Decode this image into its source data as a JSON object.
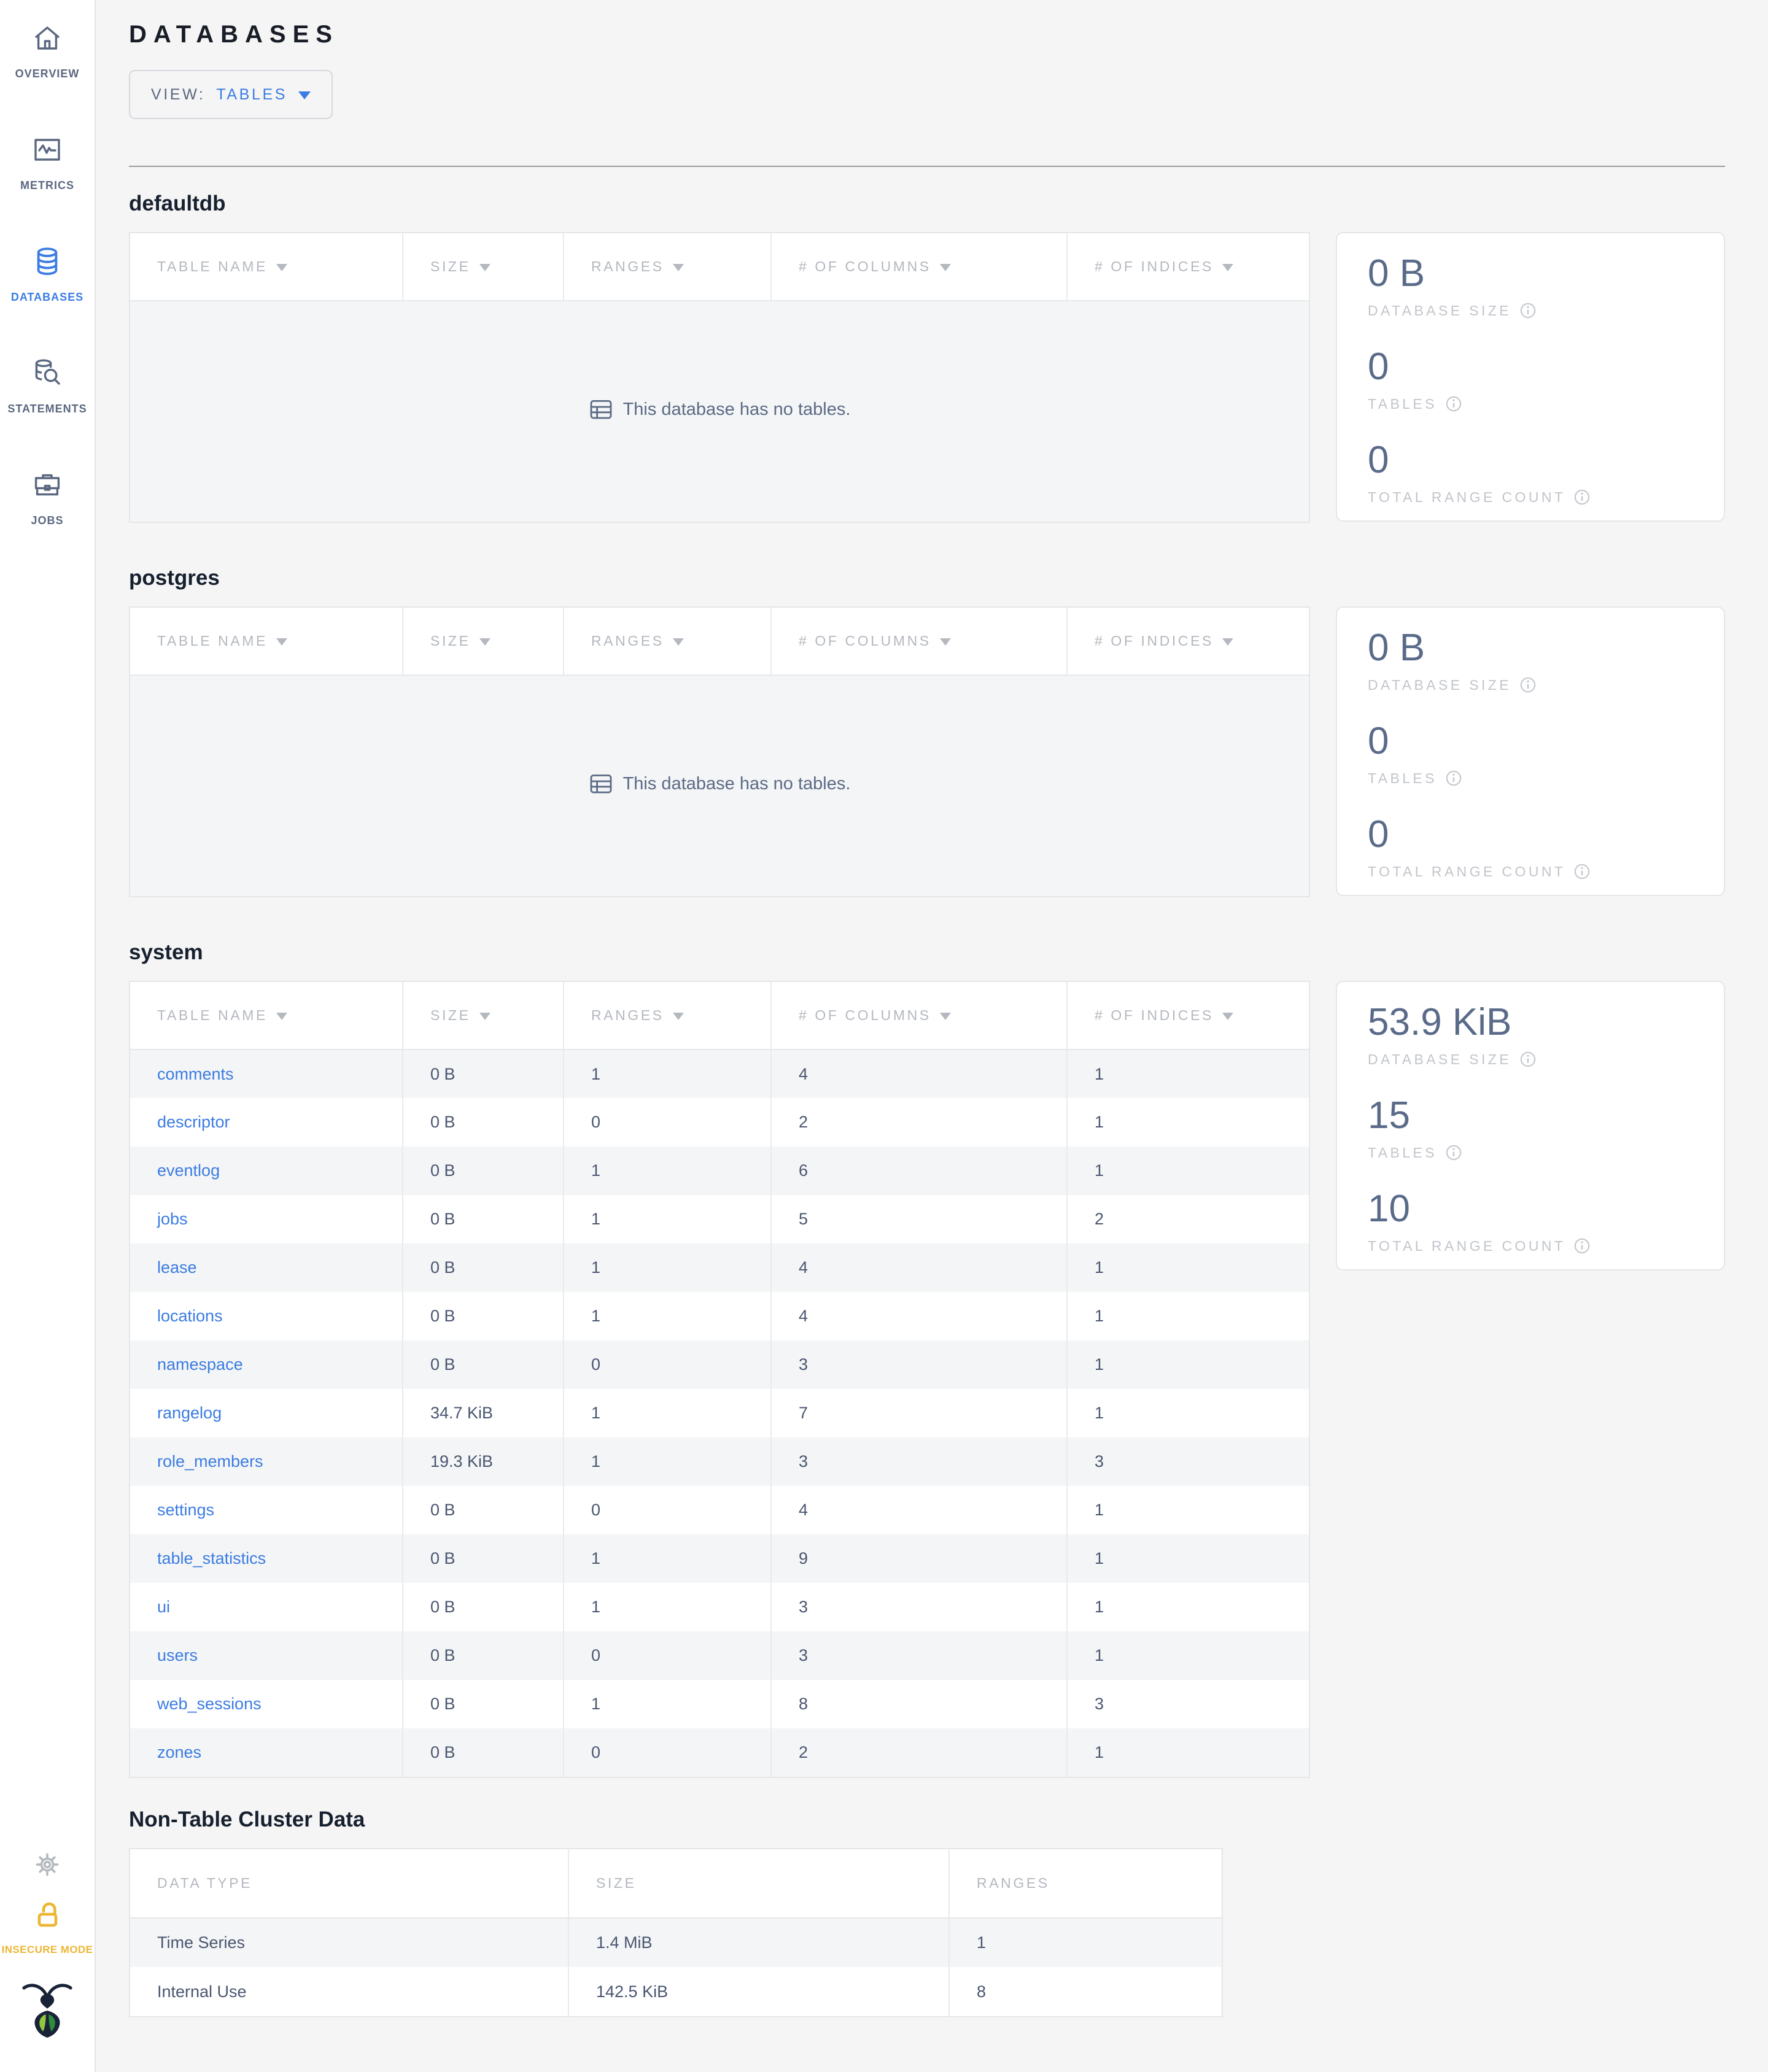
{
  "sidebar": {
    "items": [
      {
        "label": "OVERVIEW",
        "icon": "home-icon",
        "active": false
      },
      {
        "label": "METRICS",
        "icon": "metrics-icon",
        "active": false
      },
      {
        "label": "DATABASES",
        "icon": "database-icon",
        "active": true
      },
      {
        "label": "STATEMENTS",
        "icon": "statements-icon",
        "active": false
      },
      {
        "label": "JOBS",
        "icon": "jobs-icon",
        "active": false
      }
    ],
    "insecure_label": "INSECURE MODE"
  },
  "header": {
    "title": "DATABASES",
    "view_label": "VIEW:",
    "view_value": "TABLES"
  },
  "table_columns": [
    "TABLE NAME",
    "SIZE",
    "RANGES",
    "# OF COLUMNS",
    "# OF INDICES"
  ],
  "stat_labels": {
    "size": "DATABASE SIZE",
    "tables": "TABLES",
    "ranges": "TOTAL RANGE COUNT"
  },
  "empty_message": "This database has no tables.",
  "databases": [
    {
      "name": "defaultdb",
      "empty": true,
      "stats": {
        "size": "0 B",
        "tables": "0",
        "ranges": "0"
      },
      "rows": []
    },
    {
      "name": "postgres",
      "empty": true,
      "stats": {
        "size": "0 B",
        "tables": "0",
        "ranges": "0"
      },
      "rows": []
    },
    {
      "name": "system",
      "empty": false,
      "stats": {
        "size": "53.9 KiB",
        "tables": "15",
        "ranges": "10"
      },
      "rows": [
        {
          "name": "comments",
          "size": "0 B",
          "ranges": "1",
          "columns": "4",
          "indices": "1"
        },
        {
          "name": "descriptor",
          "size": "0 B",
          "ranges": "0",
          "columns": "2",
          "indices": "1"
        },
        {
          "name": "eventlog",
          "size": "0 B",
          "ranges": "1",
          "columns": "6",
          "indices": "1"
        },
        {
          "name": "jobs",
          "size": "0 B",
          "ranges": "1",
          "columns": "5",
          "indices": "2"
        },
        {
          "name": "lease",
          "size": "0 B",
          "ranges": "1",
          "columns": "4",
          "indices": "1"
        },
        {
          "name": "locations",
          "size": "0 B",
          "ranges": "1",
          "columns": "4",
          "indices": "1"
        },
        {
          "name": "namespace",
          "size": "0 B",
          "ranges": "0",
          "columns": "3",
          "indices": "1"
        },
        {
          "name": "rangelog",
          "size": "34.7 KiB",
          "ranges": "1",
          "columns": "7",
          "indices": "1"
        },
        {
          "name": "role_members",
          "size": "19.3 KiB",
          "ranges": "1",
          "columns": "3",
          "indices": "3"
        },
        {
          "name": "settings",
          "size": "0 B",
          "ranges": "0",
          "columns": "4",
          "indices": "1"
        },
        {
          "name": "table_statistics",
          "size": "0 B",
          "ranges": "1",
          "columns": "9",
          "indices": "1"
        },
        {
          "name": "ui",
          "size": "0 B",
          "ranges": "1",
          "columns": "3",
          "indices": "1"
        },
        {
          "name": "users",
          "size": "0 B",
          "ranges": "0",
          "columns": "3",
          "indices": "1"
        },
        {
          "name": "web_sessions",
          "size": "0 B",
          "ranges": "1",
          "columns": "8",
          "indices": "3"
        },
        {
          "name": "zones",
          "size": "0 B",
          "ranges": "0",
          "columns": "2",
          "indices": "1"
        }
      ]
    }
  ],
  "non_table": {
    "title": "Non-Table Cluster Data",
    "columns": [
      "DATA TYPE",
      "SIZE",
      "RANGES"
    ],
    "rows": [
      {
        "type": "Time Series",
        "size": "1.4 MiB",
        "ranges": "1"
      },
      {
        "type": "Internal Use",
        "size": "142.5 KiB",
        "ranges": "8"
      }
    ]
  },
  "colors": {
    "accent": "#3b7ce2",
    "warning": "#ecb632",
    "slate": "#5a6780",
    "link": "#3b7ce2"
  }
}
